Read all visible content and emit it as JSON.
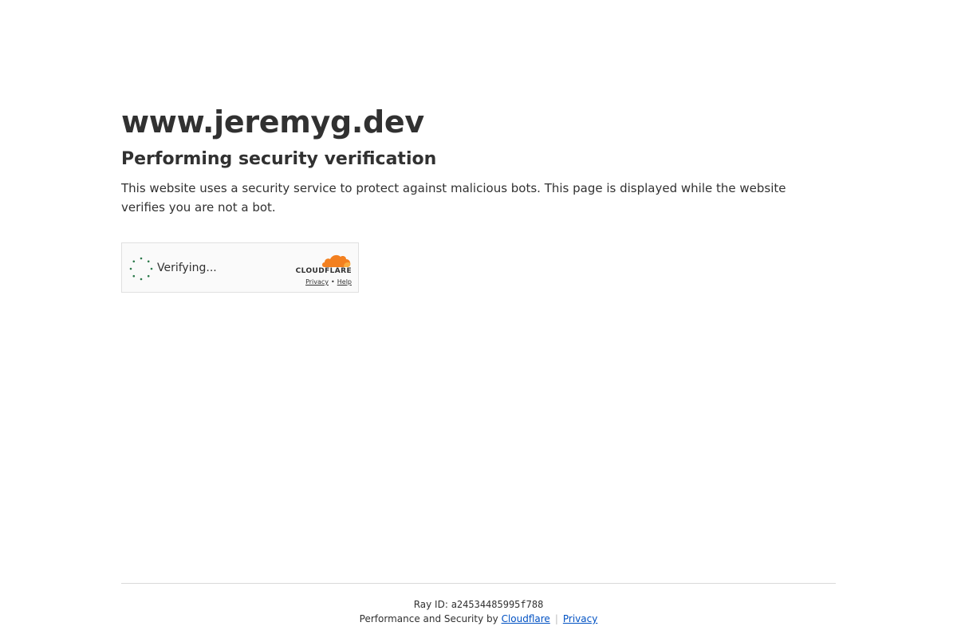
{
  "site": {
    "title": "www.jeremyg.dev"
  },
  "verification": {
    "heading": "Performing security verification",
    "description": "This website uses a security service to protect against malicious bots. This page is displayed while the website verifies you are not a bot."
  },
  "widget": {
    "status_text": "Verifying...",
    "brand_name": "CLOUDFLARE",
    "privacy_link": "Privacy",
    "help_link": "Help",
    "separator": "•",
    "spinner_color": "#2c7a4b",
    "brand_color": "#f38020"
  },
  "footer": {
    "ray_label": "Ray ID:",
    "ray_id": "a24534485995f788",
    "perf_text": "Performance and Security by",
    "cloudflare_link": "Cloudflare",
    "separator": "|",
    "privacy_link": "Privacy",
    "link_color": "#0051c3"
  }
}
